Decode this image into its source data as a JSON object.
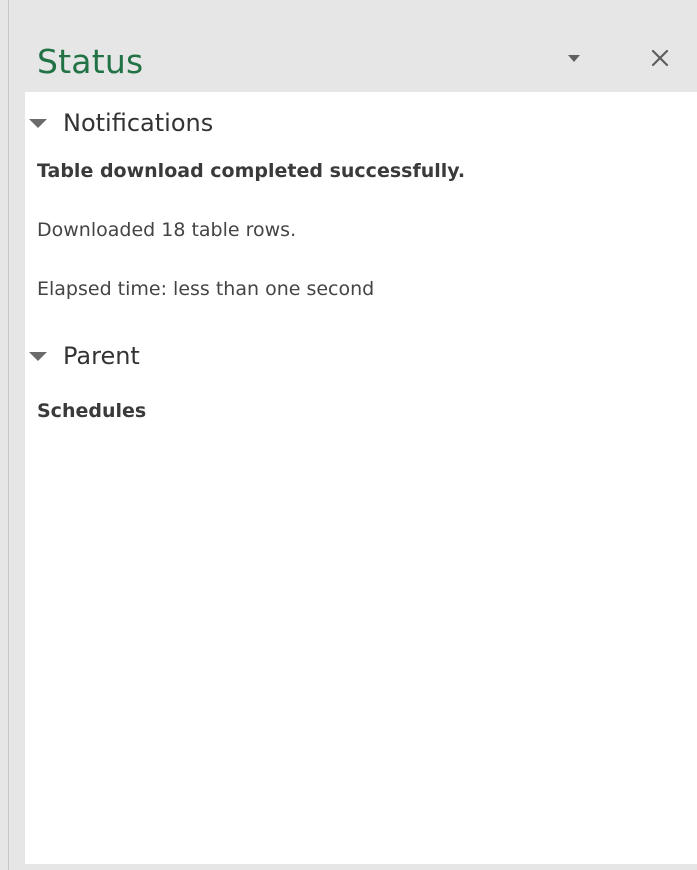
{
  "pane": {
    "title": "Status",
    "menu_icon": "chevron-down-icon",
    "close_icon": "close-icon",
    "colors": {
      "title": "#217346",
      "header_bg": "#e6e6e6",
      "content_bg": "#ffffff"
    }
  },
  "sections": {
    "notifications": {
      "label": "Notifications",
      "lines": {
        "message": "Table download completed successfully.",
        "rows": "Downloaded 18 table rows.",
        "elapsed": "Elapsed time: less than one second"
      }
    },
    "parent": {
      "label": "Parent",
      "value": "Schedules"
    }
  }
}
